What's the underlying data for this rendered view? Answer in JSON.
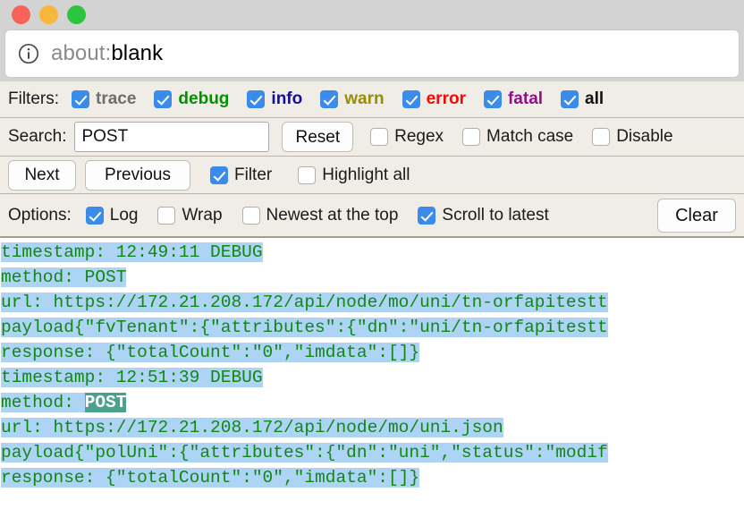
{
  "window": {
    "controls": [
      {
        "name": "close",
        "color": "#f9615b"
      },
      {
        "name": "minimize",
        "color": "#f6b73d"
      },
      {
        "name": "zoom",
        "color": "#2cc63e"
      }
    ]
  },
  "urlbar": {
    "icon": "info-circle-icon",
    "scheme": "about:",
    "value": "blank",
    "full": "about:blank"
  },
  "filters": {
    "label": "Filters:",
    "items": [
      {
        "label": "trace",
        "checked": true,
        "color": "#6e6e6e"
      },
      {
        "label": "debug",
        "checked": true,
        "color": "#049004"
      },
      {
        "label": "info",
        "checked": true,
        "color": "#16108c"
      },
      {
        "label": "warn",
        "checked": true,
        "color": "#968d08"
      },
      {
        "label": "error",
        "checked": true,
        "color": "#fb0606"
      },
      {
        "label": "fatal",
        "checked": true,
        "color": "#8e1188"
      },
      {
        "label": "all",
        "checked": true,
        "color": "#111111"
      }
    ]
  },
  "search": {
    "label": "Search:",
    "value": "POST",
    "placeholder": "",
    "reset_label": "Reset",
    "regex_label": "Regex",
    "regex_checked": false,
    "match_case_label": "Match case",
    "match_case_checked": false,
    "disable_label": "Disable",
    "disable_checked": false
  },
  "nav": {
    "next_label": "Next",
    "previous_label": "Previous",
    "filter_label": "Filter",
    "filter_checked": true,
    "highlight_all_label": "Highlight all",
    "highlight_all_checked": false
  },
  "options": {
    "label": "Options:",
    "log_label": "Log",
    "log_checked": true,
    "wrap_label": "Wrap",
    "wrap_checked": false,
    "newest_label": "Newest at the top",
    "newest_checked": false,
    "scroll_label": "Scroll to latest",
    "scroll_checked": true,
    "clear_label": "Clear"
  },
  "log": {
    "text_color": "#118811",
    "highlight_color": "#aed4f5",
    "match_color": "#4ba08f",
    "lines": [
      {
        "text": "timestamp: 12:49:11 DEBUG",
        "highlighted": true
      },
      {
        "text": "method: POST",
        "highlighted": true
      },
      {
        "text": "url: https://172.21.208.172/api/node/mo/uni/tn-orfapitestt",
        "highlighted": true
      },
      {
        "text": "payload{\"fvTenant\":{\"attributes\":{\"dn\":\"uni/tn-orfapitestt",
        "highlighted": true
      },
      {
        "text": "response: {\"totalCount\":\"0\",\"imdata\":[]}",
        "highlighted": true
      },
      {
        "text": "timestamp: 12:51:39 DEBUG",
        "highlighted": true
      },
      {
        "text": "method: POST",
        "highlighted": true,
        "match": "POST"
      },
      {
        "text": "url: https://172.21.208.172/api/node/mo/uni.json",
        "highlighted": true
      },
      {
        "text": "payload{\"polUni\":{\"attributes\":{\"dn\":\"uni\",\"status\":\"modif",
        "highlighted": true
      },
      {
        "text": "response: {\"totalCount\":\"0\",\"imdata\":[]}",
        "highlighted": true
      }
    ]
  }
}
